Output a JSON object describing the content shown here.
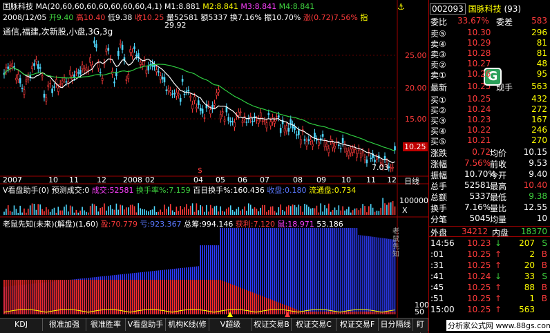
{
  "stock": {
    "name": "国脉科技",
    "ma_header": "MA(20,60,60,60,60,60,60,60,4,1)",
    "m1": "M1:8.881",
    "m2": "M2:8.841",
    "m3": "M3:8.841",
    "m4": "M4:8.841",
    "date": "2008/12/05",
    "open": "开9.40",
    "high": "高10.40",
    "low": "低9.38",
    "close": "收10.25",
    "vol": "量52581",
    "amt": "额5337",
    "turn": "换7.16%",
    "amp": "振10.70%",
    "chg": "涨(0.72)7.56%",
    "zhi": "指",
    "concepts": "通信,福建,次新股,小盘,3G,3g",
    "peak": "29.92",
    "trough": "7.03",
    "cur_tag": "10.25"
  },
  "y_axis": [
    "25.00",
    "20.00",
    "15.00"
  ],
  "x_axis": [
    "2007",
    "10",
    "11",
    "12",
    "2008",
    "02",
    "04",
    "05",
    "06",
    "07",
    "08",
    "09",
    "10",
    "11",
    "12"
  ],
  "period": "日线",
  "vol_panel": {
    "title": "V看盘助手(0)",
    "predict": "预测成交:0",
    "deal": "成交:52581",
    "turn": "换手率%:7.159",
    "hundred": "百日换手%:160.436",
    "shou": "收盘:0.180",
    "flow": "流通盘:0.734",
    "scale": "100000",
    "scale_x": "X"
  },
  "ind_panel": {
    "title": "老鼠先知(未来)(解盘)(1,60)",
    "ying": "盈:70.779",
    "kui": "亏:923.367",
    "total": "总筹:994.146",
    "huoli": "获利:7.120",
    "shu": "鼠:18.971",
    "val": "53.186",
    "scale": "100",
    "scale2": "50",
    "vtext": "老鼠先知"
  },
  "tabs": [
    "KDJ",
    "很准加强",
    "很准胜率",
    "V看盘助手",
    "机构K线(修",
    "V超级MACD",
    "权证交易B",
    "权证交易C",
    "权证交易F",
    "日分隔线",
    "盯盘"
  ],
  "right": {
    "code": "002093",
    "name": "国脉科技",
    "suffix": "(93)",
    "weibi": "委比",
    "weibi_v": "33.67%",
    "weicha": "委差",
    "weicha_v": "583",
    "sells": [
      [
        "卖⑤",
        "10.30",
        "296"
      ],
      [
        "卖④",
        "10.29",
        "81"
      ],
      [
        "卖③",
        "10.28",
        "81"
      ],
      [
        "卖②",
        "10.27",
        "48"
      ],
      [
        "卖①",
        "10.26",
        "95"
      ]
    ],
    "latest": "最新",
    "latest_v": "10.25",
    "xianshou": "现手",
    "xianshou_v": "563",
    "buys": [
      [
        "买①",
        "10.25",
        "432"
      ],
      [
        "买②",
        "10.24",
        "272"
      ],
      [
        "买③",
        "10.23",
        "167"
      ],
      [
        "买④",
        "10.22",
        "246"
      ],
      [
        "买⑤",
        "10.21",
        "270"
      ]
    ],
    "stats": [
      [
        "涨跌",
        "0.72",
        "均价",
        "10.15"
      ],
      [
        "涨幅",
        "7.56%",
        "前收",
        "9.53"
      ],
      [
        "振幅",
        "10.70%",
        "今开",
        "9.40"
      ],
      [
        "总手",
        "52581",
        "最高",
        "10.40"
      ],
      [
        "总额",
        "5337",
        "最低",
        "9.38"
      ],
      [
        "换手",
        "7.16%",
        "量比",
        "12.55"
      ],
      [
        "分笔",
        "5045",
        "均量",
        "10"
      ]
    ],
    "waipan": "外盘",
    "waipan_v": "34212",
    "neipan": "内盘",
    "neipan_v": "18370",
    "ticks": [
      [
        "14:56",
        "10.23",
        "↓",
        "207",
        "S"
      ],
      [
        ":01",
        "10.25",
        "↑",
        "2",
        "B"
      ],
      [
        ":31",
        "10.25",
        "↑",
        "20",
        "B"
      ],
      [
        ":41",
        "10.24",
        "↓",
        "33",
        "S"
      ],
      [
        ":45",
        "10.25",
        "↑",
        "88",
        "B"
      ],
      [
        ":51",
        "10.25",
        "↑",
        "1",
        "B"
      ],
      [
        "15:00",
        "10.25",
        "↑",
        "563",
        ""
      ]
    ],
    "watermark": "分析家公式网 www.88gs.com",
    "logo": "G"
  }
}
